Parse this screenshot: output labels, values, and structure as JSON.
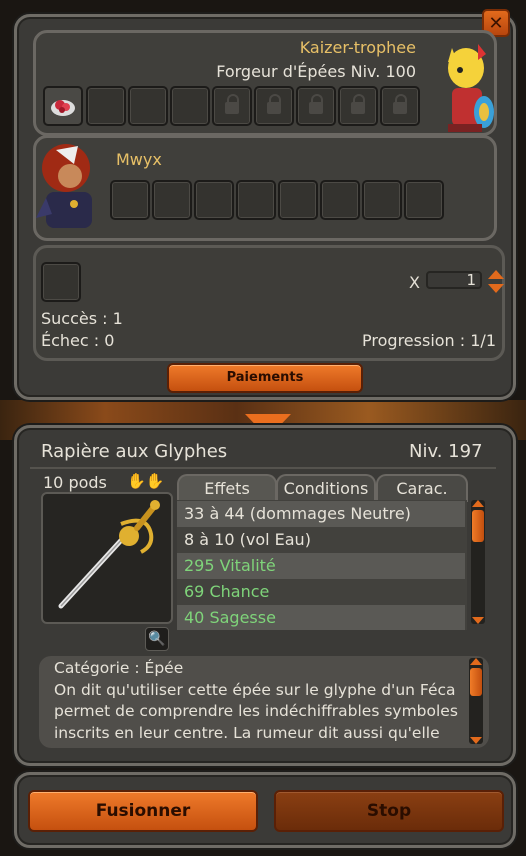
{
  "window": {
    "close_label": "✕"
  },
  "crafter": {
    "name": "Kaizer-trophee",
    "job": "Forgeur d'Épées Niv. 100",
    "slot_icons": [
      "red-ingredient-icon"
    ],
    "open_slots": 4,
    "locked_slots": 5
  },
  "client": {
    "name": "Mwyx",
    "slots": 8
  },
  "status": {
    "success": "Succès : 1",
    "failure": "Échec : 0",
    "quantity_label": "X",
    "quantity_value": "1",
    "progress": "Progression : 1/1"
  },
  "buttons": {
    "payments": "Paiements",
    "fuse": "Fusionner",
    "stop": "Stop"
  },
  "item": {
    "name": "Rapière aux Glyphes",
    "level": "Niv. 197",
    "weight": "10 pods",
    "tabs": [
      "Effets",
      "Conditions",
      "Carac."
    ],
    "effects": [
      "33 à 44 (dommages Neutre)",
      "8 à 10 (vol Eau)",
      "295 Vitalité",
      "69 Chance",
      "40 Sagesse"
    ],
    "description_lines": [
      "Catégorie : Épée",
      "On dit qu'utiliser cette épée sur le glyphe d'un Féca",
      "permet de comprendre les indéchiffrables symboles",
      "inscrits en leur centre. La rumeur dit aussi qu'elle"
    ]
  },
  "colors": {
    "accent_orange": "#e26a1c",
    "name_gold": "#e7c067",
    "stat_green": "#7fd47a"
  }
}
